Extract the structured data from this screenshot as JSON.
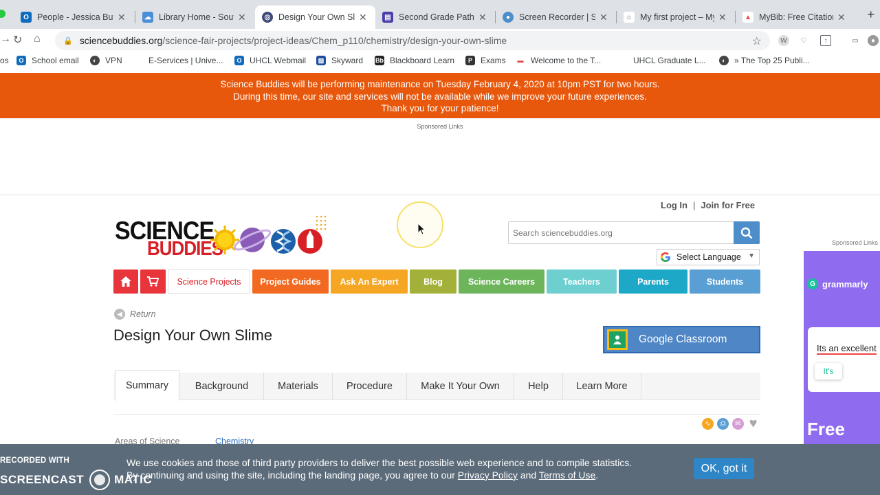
{
  "browser": {
    "tabs": [
      {
        "label": "People - Jessica Bufo",
        "color": "#0f6cbd",
        "glyph": "O"
      },
      {
        "label": "Library Home - South",
        "color": "#4a90d9",
        "glyph": "☁"
      },
      {
        "label": "Design Your Own Slim",
        "color": "#3d4a7a",
        "glyph": "◎"
      },
      {
        "label": "Second Grade Pathfi",
        "color": "#4a3ea8",
        "glyph": "▤"
      },
      {
        "label": "Screen Recorder | Sc",
        "color": "#4d8dc9",
        "glyph": "●"
      },
      {
        "label": "My first project – MyB",
        "color": "#888888",
        "glyph": "🏛"
      },
      {
        "label": "MyBib: Free Citation",
        "color": "#e94b3c",
        "glyph": "▲"
      }
    ],
    "new_tab": "+",
    "url_host": "sciencebuddies.org",
    "url_path": "/science-fair-projects/project-ideas/Chem_p110/chemistry/design-your-own-slime",
    "bookmarks": [
      {
        "label": "os",
        "glyph": ""
      },
      {
        "label": "School email",
        "glyph": "O",
        "color": "#0f6cbd"
      },
      {
        "label": "VPN",
        "glyph": "◐",
        "color": "#444444"
      },
      {
        "label": "E-Services | Unive...",
        "glyph": "",
        "color": ""
      },
      {
        "label": "UHCL Webmail",
        "glyph": "O",
        "color": "#0f6cbd"
      },
      {
        "label": "Skyward",
        "glyph": "▨",
        "color": "#1f4f9c"
      },
      {
        "label": "Blackboard Learn",
        "glyph": "Bb",
        "color": "#222222"
      },
      {
        "label": "Exams",
        "glyph": "P",
        "color": "#333333"
      },
      {
        "label": "Welcome to the T...",
        "glyph": "▬",
        "color": "#d44"
      },
      {
        "label": "UHCL Graduate L...",
        "glyph": "",
        "color": ""
      },
      {
        "label": "» The Top 25 Publi...",
        "glyph": "◐",
        "color": "#444444"
      }
    ]
  },
  "maintenance": {
    "line1": "Science Buddies will be performing maintenance on Tuesday February 4, 2020 at 10pm PST for two hours.",
    "line2": "During this time, our site and services will not be available while we improve your future experiences.",
    "line3": "Thank you for your patience!"
  },
  "sponsored_top": "Sponsored Links",
  "sponsored_right": "Sponsored Links",
  "header": {
    "login": "Log In",
    "separator": "|",
    "join": "Join for Free",
    "logo_word1": "SCIENCE",
    "logo_word2": "BUDDIES",
    "search_placeholder": "Search sciencebuddies.org",
    "language": "Select Language"
  },
  "nav": [
    {
      "label": "",
      "icon": "home-icon",
      "color": "#e8353b"
    },
    {
      "label": "",
      "icon": "cart-icon",
      "color": "#e8353b"
    },
    {
      "label": "Science Projects",
      "color": "#ffffff"
    },
    {
      "label": "Project Guides",
      "color": "#f26a21"
    },
    {
      "label": "Ask An Expert",
      "color": "#f5a623"
    },
    {
      "label": "Blog",
      "color": "#a3b13a"
    },
    {
      "label": "Science Careers",
      "color": "#6db55b"
    },
    {
      "label": "Teachers",
      "color": "#6dcfd0"
    },
    {
      "label": "Parents",
      "color": "#1ea8c8"
    },
    {
      "label": "Students",
      "color": "#5a9fd4"
    }
  ],
  "page": {
    "return_label": "Return",
    "title": "Design Your Own Slime",
    "google_classroom": "Google Classroom",
    "tabs": [
      "Summary",
      "Background",
      "Materials",
      "Procedure",
      "Make It Your Own",
      "Help",
      "Learn More"
    ],
    "areas_label": "Areas of Science",
    "areas_value": "Chemistry"
  },
  "ad_right": {
    "brand": "grammarly",
    "sample": "Its an excellent",
    "suggestion": "It's",
    "headline": "Free"
  },
  "cookie": {
    "line1": "We use cookies and those of third party providers to deliver the best possible web experience and to compile statistics.",
    "line2_prefix": "By continuing and using the site, including the landing page, you agree to our",
    "privacy": "Privacy Policy",
    "and": "and",
    "terms": "Terms of Use",
    "period": ".",
    "button": "OK, got it"
  },
  "watermark": {
    "line1": "RECORDED WITH",
    "line2a": "SCREENCAST",
    "line2b": "MATIC"
  }
}
